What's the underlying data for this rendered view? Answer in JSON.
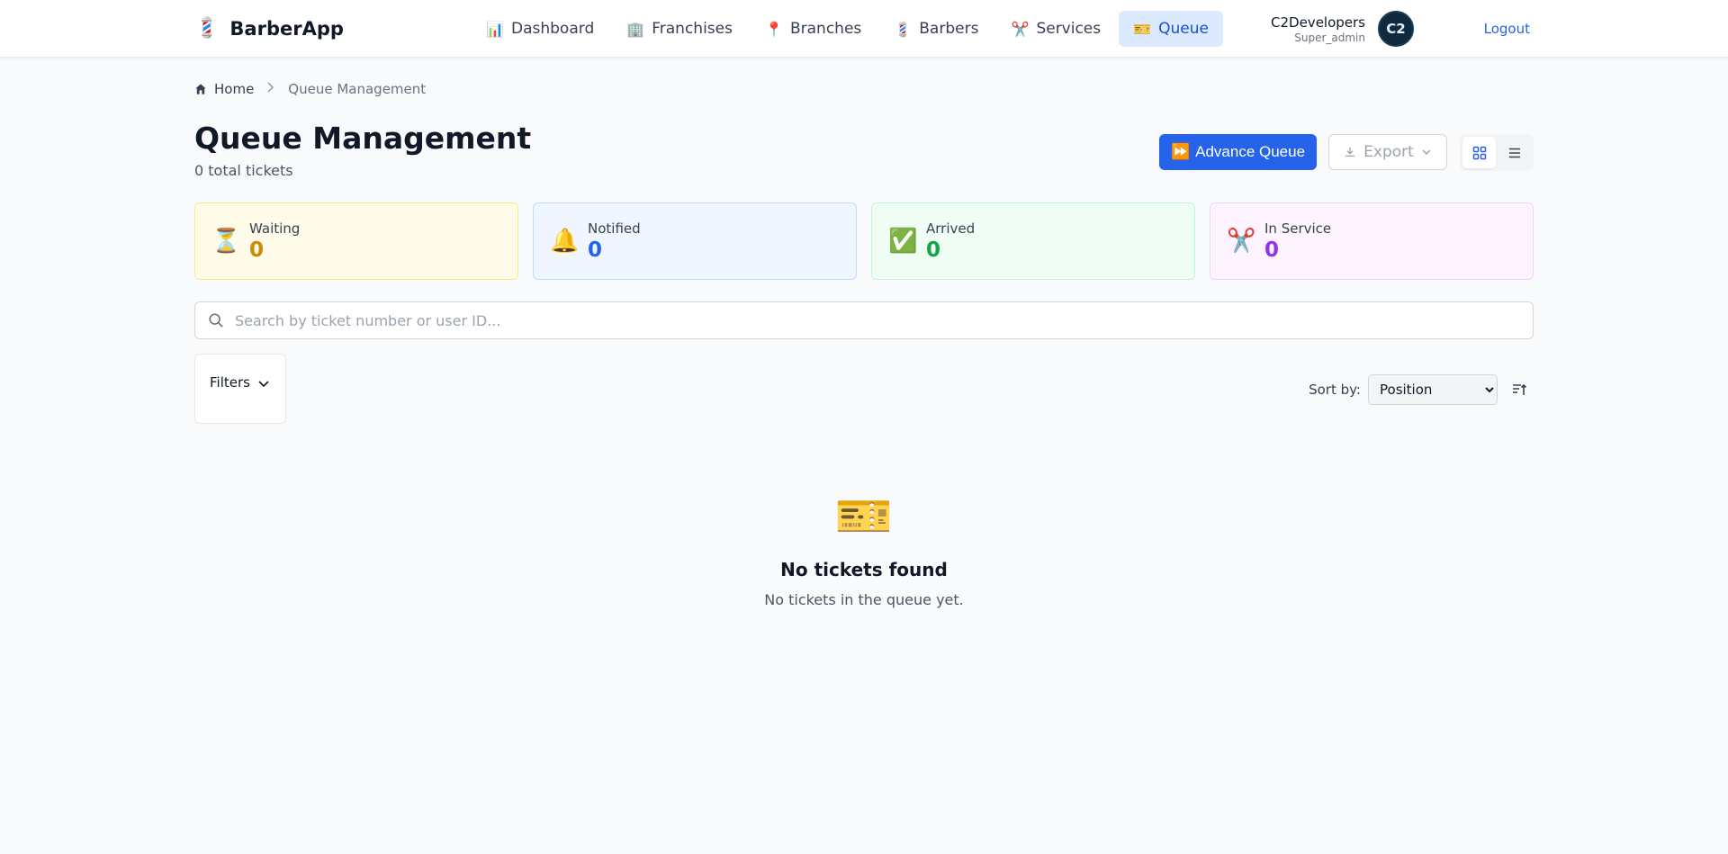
{
  "brand": {
    "icon": "💈",
    "name": "BarberApp"
  },
  "nav": [
    {
      "icon": "📊",
      "label": "Dashboard"
    },
    {
      "icon": "🏢",
      "label": "Franchises"
    },
    {
      "icon": "📍",
      "label": "Branches"
    },
    {
      "icon": "💈",
      "label": "Barbers"
    },
    {
      "icon": "✂️",
      "label": "Services"
    },
    {
      "icon": "🎫",
      "label": "Queue",
      "active": true
    }
  ],
  "user": {
    "name": "C2Developers",
    "role": "Super_admin",
    "avatar_text": "C2",
    "logout_label": "Logout"
  },
  "breadcrumb": {
    "home": "Home",
    "current": "Queue Management"
  },
  "header": {
    "title": "Queue Management",
    "subtitle": "0 total tickets"
  },
  "actions": {
    "advance_icon": "⏩",
    "advance_label": "Advance Queue",
    "export_label": "Export"
  },
  "stats": [
    {
      "icon": "⏳",
      "label": "Waiting",
      "value": "0"
    },
    {
      "icon": "🔔",
      "label": "Notified",
      "value": "0"
    },
    {
      "icon": "✅",
      "label": "Arrived",
      "value": "0"
    },
    {
      "icon": "✂️",
      "label": "In Service",
      "value": "0"
    }
  ],
  "search": {
    "placeholder": "Search by ticket number or user ID...",
    "value": ""
  },
  "filters": {
    "label": "Filters"
  },
  "sort": {
    "label": "Sort by:",
    "selected": "Position"
  },
  "empty": {
    "icon": "🎫",
    "title": "No tickets found",
    "text": "No tickets in the queue yet."
  },
  "colors": {
    "primary": "#2563eb",
    "active_nav_bg": "#dbeafe",
    "waiting": "#ca8a04",
    "notified": "#2563eb",
    "arrived": "#16a34a",
    "in_service": "#9333ea"
  }
}
